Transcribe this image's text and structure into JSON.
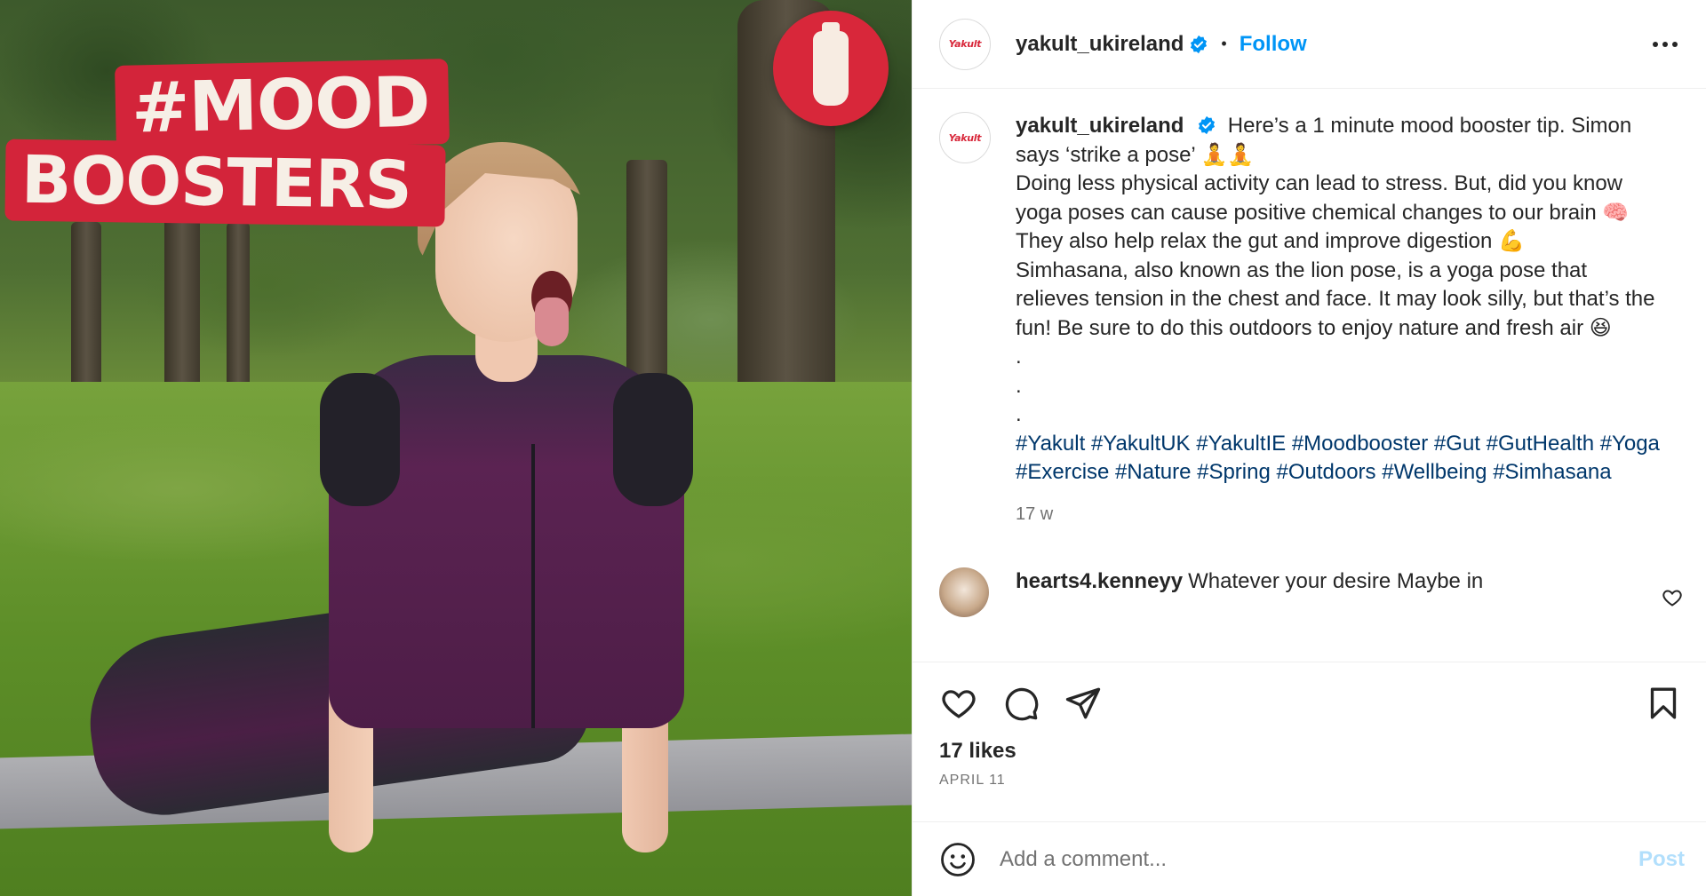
{
  "media": {
    "headline_line1": "#MOOD",
    "headline_line2": "BOOSTERS",
    "brand_color": "#d8273a"
  },
  "header": {
    "avatar_logo": "Yakult",
    "username": "yakult_ukireland",
    "verified_icon": "verified-badge-icon",
    "separator": "•",
    "follow_label": "Follow",
    "more_icon": "more-options-icon"
  },
  "caption": {
    "username": "yakult_ukireland",
    "line1": "Here’s a 1 minute mood booster tip. Simon says ‘strike a pose’ 🧘🧘",
    "line2": "Doing less physical activity can lead to stress. But, did you know yoga poses can cause positive chemical changes to our brain 🧠 They also help relax the gut and improve digestion 💪",
    "line3": "Simhasana, also known as the lion pose, is a yoga pose that relieves tension in the chest and face. It may look silly, but that’s the fun! Be sure to do this outdoors to enjoy nature and fresh air 😆",
    "dot1": ".",
    "dot2": ".",
    "dot3": ".",
    "hashtags": "#Yakult #YakultUK #YakultIE #Moodbooster #Gut #GutHealth #Yoga #Exercise #Nature #Spring #Outdoors #Wellbeing #Simhasana",
    "timestamp": "17 w"
  },
  "comment": {
    "username": "hearts4.kenneyy",
    "text": "Whatever your desire Maybe in"
  },
  "actions": {
    "like_icon": "heart-icon",
    "comment_icon": "comment-icon",
    "share_icon": "share-icon",
    "save_icon": "bookmark-icon",
    "likes_text": "17 likes",
    "date_text": "APRIL 11"
  },
  "add_comment": {
    "placeholder": "Add a comment...",
    "post_label": "Post",
    "emoji_icon": "emoji-icon"
  },
  "colors": {
    "link_blue": "#0095f6",
    "hashtag": "#00376b",
    "muted": "#737373",
    "post_disabled": "#b2dffc"
  }
}
